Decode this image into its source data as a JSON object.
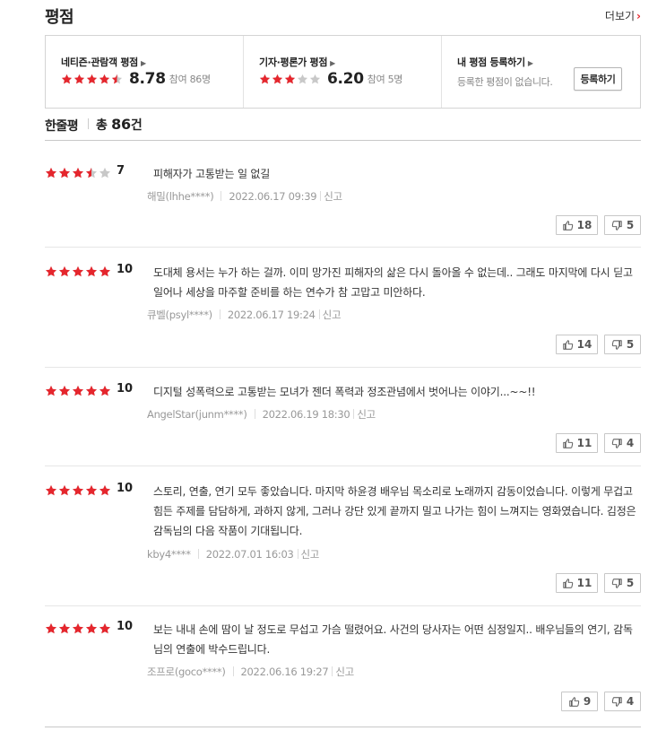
{
  "header": {
    "title": "평점",
    "more_label": "더보기"
  },
  "colors": {
    "star_on": "#e5262d",
    "star_off": "#c8c8c8",
    "accent": "#e5262d"
  },
  "summary": {
    "netizen": {
      "label": "네티즌·관람객 평점",
      "score": "8.78",
      "count": "참여 86명",
      "stars": 4.5
    },
    "critic": {
      "label": "기자·평론가 평점",
      "score": "6.20",
      "count": "참여 5명",
      "stars": 3
    },
    "mine": {
      "label": "내 평점 등록하기",
      "empty": "등록한 평점이 없습니다.",
      "button": "등록하기"
    }
  },
  "oneline": {
    "title": "한줄평",
    "total_prefix": "총 ",
    "total_count": "86",
    "total_suffix": "건"
  },
  "reviews": [
    {
      "stars": 3.5,
      "score": "7",
      "text": "피해자가 고통받는 일 없길",
      "user": "해밀(lhhe****)",
      "date": "2022.06.17 09:39",
      "report": "신고",
      "up": "18",
      "down": "5"
    },
    {
      "stars": 5,
      "score": "10",
      "text": "도대체 용서는 누가 하는 걸까. 이미 망가진 피해자의 삶은 다시 돌아올 수 없는데.. 그래도 마지막에 다시 딛고 일어나 세상을 마주할 준비를 하는 연수가 참 고맙고 미안하다.",
      "user": "큐벨(psyl****)",
      "date": "2022.06.17 19:24",
      "report": "신고",
      "up": "14",
      "down": "5"
    },
    {
      "stars": 5,
      "score": "10",
      "text": "디지털 성폭력으로 고통받는 모녀가 젠더 폭력과 정조관념에서 벗어나는 이야기...~~!!",
      "user": "AngelStar(junm****)",
      "date": "2022.06.19 18:30",
      "report": "신고",
      "up": "11",
      "down": "4"
    },
    {
      "stars": 5,
      "score": "10",
      "text": "스토리, 연출, 연기 모두 좋았습니다. 마지막 하윤경 배우님 목소리로 노래까지 감동이었습니다. 이렇게 무겁고 힘든 주제를 담담하게, 과하지 않게, 그러나 강단 있게 끝까지 밀고 나가는 힘이 느껴지는 영화였습니다. 김정은 감독님의 다음 작품이 기대됩니다.",
      "user": "kby4****",
      "date": "2022.07.01 16:03",
      "report": "신고",
      "up": "11",
      "down": "5"
    },
    {
      "stars": 5,
      "score": "10",
      "text": "보는 내내 손에 땀이 날 정도로 무섭고 가슴 떨렸어요. 사건의 당사자는 어떤 심정일지.. 배우님들의 연기, 감독님의 연출에 박수드립니다.",
      "user": "조프로(goco****)",
      "date": "2022.06.16 19:27",
      "report": "신고",
      "up": "9",
      "down": "4"
    }
  ]
}
